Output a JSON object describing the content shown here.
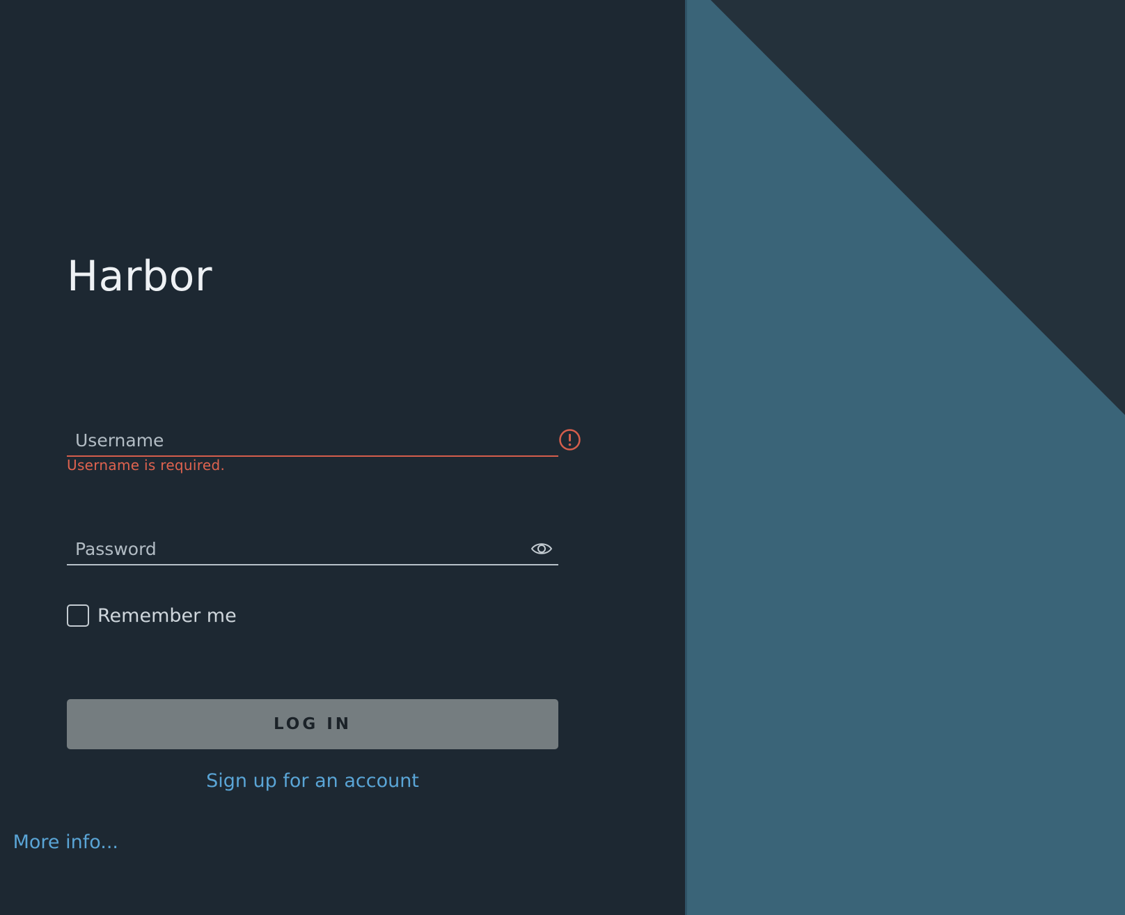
{
  "app": {
    "title": "Harbor"
  },
  "form": {
    "username": {
      "placeholder": "Username",
      "value": "",
      "error": "Username is required."
    },
    "password": {
      "placeholder": "Password",
      "value": ""
    },
    "remember_me": {
      "label": "Remember me",
      "checked": false
    },
    "login_button": "LOG IN",
    "signup_link": "Sign up for an account",
    "more_info_link": "More info..."
  },
  "icons": {
    "error": "exclamation-circle-icon",
    "password_toggle": "eye-icon"
  },
  "colors": {
    "background": "#1d2832",
    "art_primary": "#3a6478",
    "art_dark": "#24313b",
    "error": "#d55e4c",
    "link": "#5aa5d6",
    "button": "#757d80"
  }
}
